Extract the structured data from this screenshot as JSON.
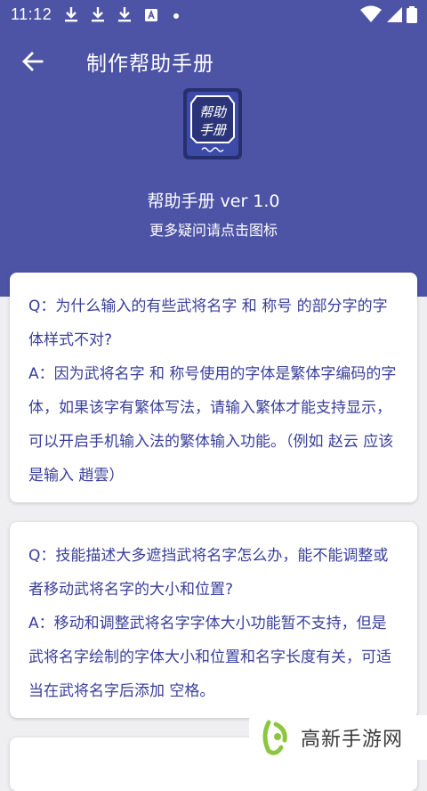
{
  "status_bar": {
    "time": "11:12",
    "icons": [
      "download-icon",
      "download-icon",
      "download-icon",
      "font-icon",
      "dot-icon",
      "wifi-icon",
      "cellular-icon",
      "battery-icon"
    ]
  },
  "toolbar": {
    "title": "制作帮助手册",
    "back_icon": "arrow-left-icon"
  },
  "app_info": {
    "icon_text_top": "帮助",
    "icon_text_bottom": "手册",
    "version": "帮助手册 ver 1.0",
    "hint": "更多疑问请点击图标"
  },
  "faq": [
    {
      "question": "Q：为什么输入的有些武将名字 和 称号 的部分字的字体样式不对?",
      "answer": "A：因为武将名字 和 称号使用的字体是繁体字编码的字体，如果该字有繁体写法，请输入繁体才能支持显示，可以开启手机输入法的繁体输入功能。（例如 赵云 应该是输入 趙雲）"
    },
    {
      "question": "Q：技能描述大多遮挡武将名字怎么办，能不能调整或者移动武将名字的大小和位置?",
      "answer": "A：移动和调整武将名字字体大小功能暂不支持，但是武将名字绘制的字体大小和位置和名字长度有关，可适当在武将名字后添加 空格。"
    }
  ],
  "watermark": {
    "text": "高新手游网"
  },
  "colors": {
    "header": "#4d53a5",
    "card_text": "#3a3f9a",
    "background": "#efeff1",
    "watermark_green": "#8cc63f"
  }
}
